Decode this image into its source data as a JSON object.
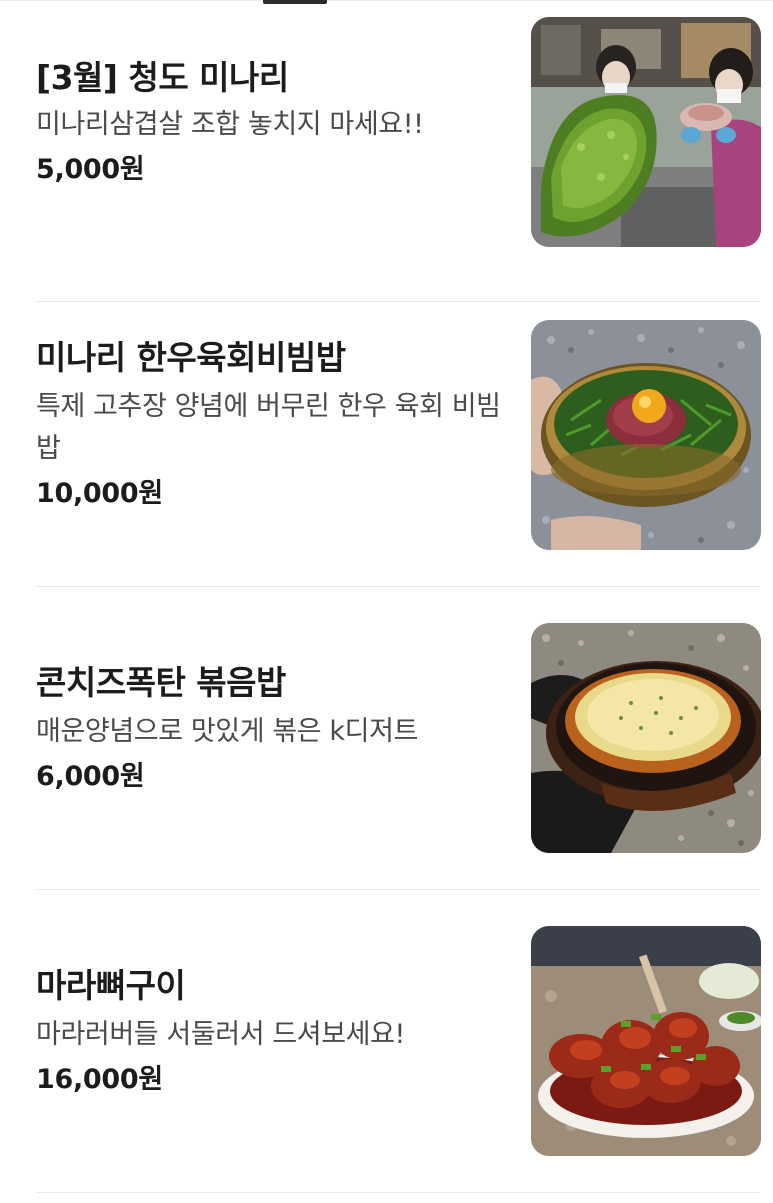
{
  "menu": {
    "items": [
      {
        "name": "[3월] 청도 미나리",
        "description": "미나리삼겹살 조합 놓치지 마세요!!",
        "price": "5,000원",
        "image_icon": "photo-minari-bundle"
      },
      {
        "name": "미나리 한우육회비빔밥",
        "description": "특제 고추장 양념에 버무린 한우 육회 비빔밥",
        "price": "10,000원",
        "image_icon": "photo-yukhoe-bibimbap"
      },
      {
        "name": "콘치즈폭탄 볶음밥",
        "description": "매운양념으로 맛있게 볶은 k디저트",
        "price": "6,000원",
        "image_icon": "photo-corn-cheese-fried-rice"
      },
      {
        "name": "마라뼈구이",
        "description": "마라러버들 서둘러서 드셔보세요!",
        "price": "16,000원",
        "image_icon": "photo-mala-ribs"
      }
    ]
  }
}
